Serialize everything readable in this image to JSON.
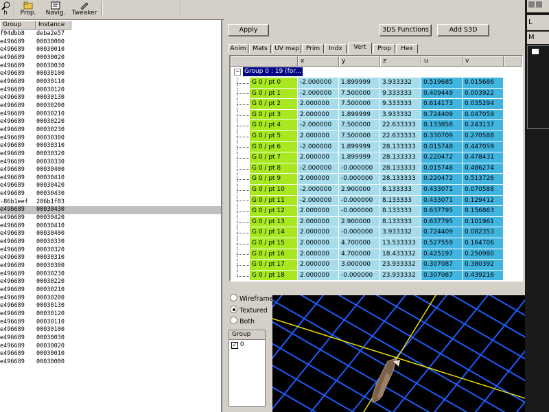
{
  "toolbar": {
    "buttons": [
      {
        "label": "h",
        "icon": "search-icon"
      },
      {
        "label": "Prop.",
        "icon": "folder-icon"
      },
      {
        "label": "Navig.",
        "icon": "navigate-icon"
      },
      {
        "label": "Tweaker",
        "icon": "wrench-icon"
      }
    ]
  },
  "left_list": {
    "headers": [
      "Group",
      "Instance"
    ],
    "rows": [
      [
        "f94dbb8",
        "deba2e57"
      ],
      [
        "e496689",
        "00030000"
      ],
      [
        "e496689",
        "00030010"
      ],
      [
        "e496689",
        "00030020"
      ],
      [
        "e496689",
        "00030030"
      ],
      [
        "e496689",
        "00030100"
      ],
      [
        "e496689",
        "00030110"
      ],
      [
        "e496689",
        "00030120"
      ],
      [
        "e496689",
        "00030130"
      ],
      [
        "e496689",
        "00030200"
      ],
      [
        "e496689",
        "00030210"
      ],
      [
        "e496689",
        "00030220"
      ],
      [
        "e496689",
        "00030230"
      ],
      [
        "e496689",
        "00030300"
      ],
      [
        "e496689",
        "00030310"
      ],
      [
        "e496689",
        "00030320"
      ],
      [
        "e496689",
        "00030330"
      ],
      [
        "e496689",
        "00030400"
      ],
      [
        "e496689",
        "00030410"
      ],
      [
        "e496689",
        "00030420"
      ],
      [
        "e496689",
        "00030430"
      ],
      [
        "-86b1eef",
        "286b1f03"
      ],
      [
        "e496689",
        "00030430"
      ],
      [
        "e496689",
        "00030420"
      ],
      [
        "e496689",
        "00030410"
      ],
      [
        "e496689",
        "00030400"
      ],
      [
        "e496689",
        "00030330"
      ],
      [
        "e496689",
        "00030320"
      ],
      [
        "e496689",
        "00030310"
      ],
      [
        "e496689",
        "00030300"
      ],
      [
        "e496689",
        "00030230"
      ],
      [
        "e496689",
        "00030220"
      ],
      [
        "e496689",
        "00030210"
      ],
      [
        "e496689",
        "00030200"
      ],
      [
        "e496689",
        "00030130"
      ],
      [
        "e496689",
        "00030120"
      ],
      [
        "e496689",
        "00030110"
      ],
      [
        "e496689",
        "00030100"
      ],
      [
        "e496689",
        "00030030"
      ],
      [
        "e496689",
        "00030020"
      ],
      [
        "e496689",
        "00030010"
      ],
      [
        "e496689",
        "00030000"
      ]
    ],
    "selected_index": 22
  },
  "main": {
    "apply_label": "Apply",
    "functions_label": "3DS Functions",
    "add_label": "Add S3D",
    "tabs": [
      "Anim",
      "Mats",
      "UV map",
      "Prim",
      "Indx",
      "Vert",
      "Prop",
      "Hex"
    ],
    "active_tab": "Vert",
    "grid": {
      "headers": [
        "",
        "x",
        "y",
        "z",
        "u",
        "v"
      ],
      "group_label": "Group 0 : 19 (for...",
      "rows": [
        [
          "G 0 / pt 0",
          "-2.000000",
          "1.899999",
          "3.933332",
          "0.519685",
          "0.015686"
        ],
        [
          "G 0 / pt 1",
          "-2.000000",
          "7.500000",
          "9.333333",
          "0.409449",
          "0.003922"
        ],
        [
          "G 0 / pt 2",
          "2.000000",
          "7.500000",
          "9.333333",
          "0.614173",
          "0.035294"
        ],
        [
          "G 0 / pt 3",
          "2.000000",
          "1.899999",
          "3.933332",
          "0.724409",
          "0.047059"
        ],
        [
          "G 0 / pt 4",
          "-2.000000",
          "7.500000",
          "22.633333",
          "0.133858",
          "0.243137"
        ],
        [
          "G 0 / pt 5",
          "2.000000",
          "7.500000",
          "22.633333",
          "0.330709",
          "0.270588"
        ],
        [
          "G 0 / pt 6",
          "-2.000000",
          "1.899999",
          "28.133333",
          "0.015748",
          "0.447059"
        ],
        [
          "G 0 / pt 7",
          "2.000000",
          "1.899999",
          "28.133333",
          "0.220472",
          "0.478431"
        ],
        [
          "G 0 / pt 8",
          "-2.000000",
          "-0.000000",
          "28.133333",
          "0.015748",
          "0.486274"
        ],
        [
          "G 0 / pt 9",
          "2.000000",
          "-0.000000",
          "28.133333",
          "0.220472",
          "0.513726"
        ],
        [
          "G 0 / pt 10",
          "-2.000000",
          "2.900000",
          "8.133333",
          "0.433071",
          "0.070588"
        ],
        [
          "G 0 / pt 11",
          "-2.000000",
          "-0.000000",
          "8.133333",
          "0.433071",
          "0.129412"
        ],
        [
          "G 0 / pt 12",
          "2.000000",
          "-0.000000",
          "8.133333",
          "0.637795",
          "0.156863"
        ],
        [
          "G 0 / pt 13",
          "2.000000",
          "2.900000",
          "8.133333",
          "0.637795",
          "0.101961"
        ],
        [
          "G 0 / pt 14",
          "2.000000",
          "-0.000000",
          "3.933332",
          "0.724409",
          "0.082353"
        ],
        [
          "G 0 / pt 15",
          "2.000000",
          "4.700000",
          "13.533333",
          "0.527559",
          "0.164706"
        ],
        [
          "G 0 / pt 16",
          "2.000000",
          "4.700000",
          "18.433332",
          "0.425197",
          "0.250980"
        ],
        [
          "G 0 / pt 17",
          "2.000000",
          "3.000000",
          "23.933332",
          "0.307087",
          "0.380392"
        ],
        [
          "G 0 / pt 18",
          "2.000000",
          "-0.000000",
          "23.933332",
          "0.307087",
          "0.439216"
        ]
      ]
    },
    "view_modes": [
      {
        "label": "Wireframe",
        "checked": false
      },
      {
        "label": "Textured",
        "checked": true
      },
      {
        "label": "Both",
        "checked": false
      }
    ],
    "group_list": {
      "header": "Group",
      "items": [
        {
          "label": "0",
          "checked": true
        }
      ]
    }
  },
  "colors": {
    "name_cell": "#a8e820",
    "xyz_cell": "#a6dcec",
    "uv_cell": "#42b4e0",
    "grid_lines": "#1e5cff",
    "axis_line": "#f0e000",
    "viewport_bg": "#000000"
  },
  "right_strip": {
    "letters": [
      "L",
      "M"
    ]
  }
}
